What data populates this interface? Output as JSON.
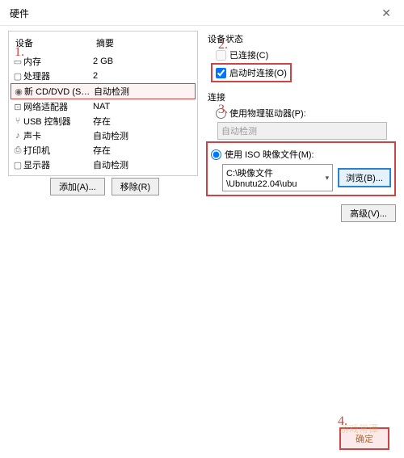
{
  "title": "硬件",
  "headers": {
    "device": "设备",
    "summary": "摘要"
  },
  "devices": [
    {
      "name": "内存",
      "summary": "2 GB"
    },
    {
      "name": "处理器",
      "summary": "2"
    },
    {
      "name": "新 CD/DVD (SATA)",
      "summary": "自动检测"
    },
    {
      "name": "网络适配器",
      "summary": "NAT"
    },
    {
      "name": "USB 控制器",
      "summary": "存在"
    },
    {
      "name": "声卡",
      "summary": "自动检测"
    },
    {
      "name": "打印机",
      "summary": "存在"
    },
    {
      "name": "显示器",
      "summary": "自动检测"
    }
  ],
  "status": {
    "title": "设备状态",
    "connected": "已连接(C)",
    "connectAtPowerOn": "启动时连接(O)"
  },
  "connection": {
    "title": "连接",
    "physical": "使用物理驱动器(P):",
    "autoDetect": "自动检测",
    "iso": "使用 ISO 映像文件(M):",
    "path": "C:\\映像文件\\Ubnutu22.04\\ubu",
    "browse": "浏览(B)..."
  },
  "advanced": "高级(V)...",
  "buttons": {
    "add": "添加(A)...",
    "remove": "移除(R)",
    "ok": "确定"
  },
  "annotations": {
    "a1": "1.",
    "a2": "2.",
    "a3": "3.",
    "a4": "4."
  },
  "watermark": "游戏常谭"
}
